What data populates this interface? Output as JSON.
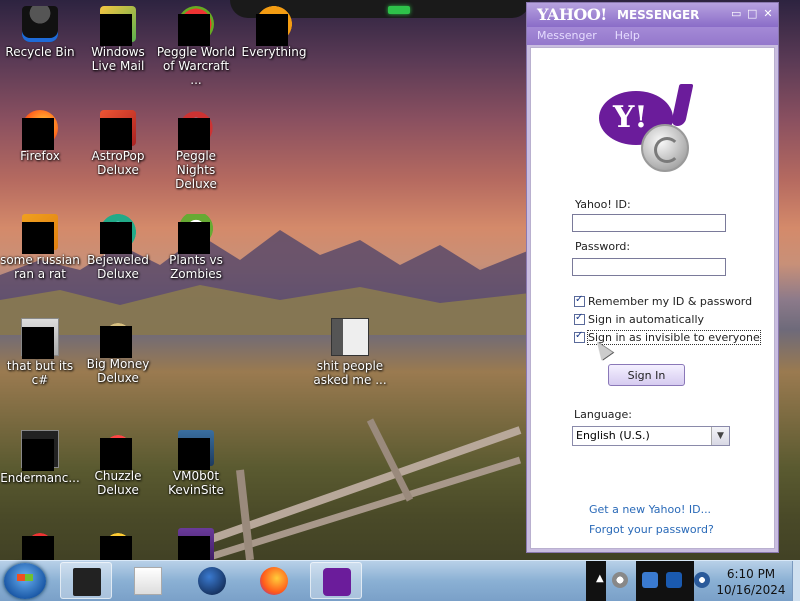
{
  "desktop": {
    "icons": [
      {
        "label": "Recycle Bin"
      },
      {
        "label": "Windows Live Mail"
      },
      {
        "label": "Peggle World of Warcraft ..."
      },
      {
        "label": "Everything"
      },
      {
        "label": "Firefox"
      },
      {
        "label": "AstroPop Deluxe"
      },
      {
        "label": "Peggle Nights Deluxe"
      },
      {
        "label": "some russian ran a rat"
      },
      {
        "label": "Bejeweled Deluxe"
      },
      {
        "label": "Plants vs Zombies"
      },
      {
        "label": "that but its c#"
      },
      {
        "label": "Big Money Deluxe"
      },
      {
        "label": "shit people asked me ..."
      },
      {
        "label": "Endermanc..."
      },
      {
        "label": "Chuzzle Deluxe"
      },
      {
        "label": "VM0b0t KevinSite"
      }
    ]
  },
  "messenger": {
    "logo": "YAHOO!",
    "title": "MESSENGER",
    "menu": [
      "Messenger",
      "Help"
    ],
    "controls": {
      "minimize": "▭",
      "maximize": "□",
      "close": "✕"
    },
    "yahoo_id_label": "Yahoo! ID:",
    "yahoo_id_value": "",
    "password_label": "Password:",
    "password_value": "",
    "checkboxes": [
      {
        "label": "Remember my ID & password",
        "checked": true
      },
      {
        "label": "Sign in automatically",
        "checked": true
      },
      {
        "label": "Sign in as invisible to everyone",
        "checked": true
      }
    ],
    "signin_label": "Sign In",
    "language_label": "Language:",
    "language_value": "English (U.S.)",
    "links": [
      "Get a new Yahoo! ID...",
      "Forgot your password?"
    ]
  },
  "taskbar": {
    "clock_time": "6:10 PM",
    "clock_date": "10/16/2024"
  },
  "colors": {
    "yahoo_purple": "#6b1c9b",
    "titlebar": "#8a6cc8",
    "link": "#2a6ab8"
  }
}
